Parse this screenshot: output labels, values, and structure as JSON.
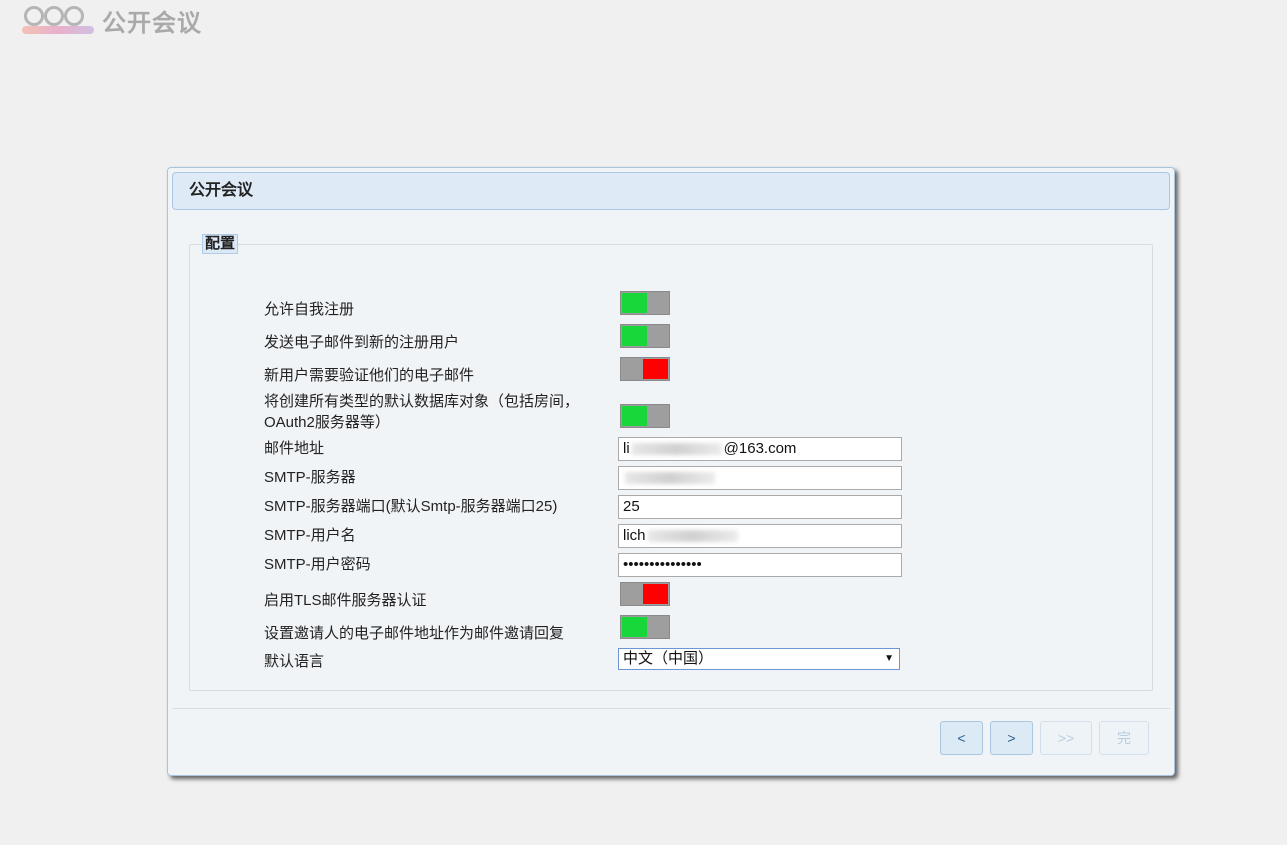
{
  "app": {
    "logo_text": "公开会议"
  },
  "dialog": {
    "title": "公开会议",
    "fieldset_legend": "配置",
    "settings": {
      "allow_self_registration": {
        "label": "允许自我注册",
        "state": "on"
      },
      "send_email_new_users": {
        "label": "发送电子邮件到新的注册用户",
        "state": "on"
      },
      "verify_email": {
        "label": "新用户需要验证他们的电子邮件",
        "state": "off"
      },
      "create_default_objects": {
        "label_line1": "将创建所有类型的默认数据库对象（包括房间，",
        "label_line2": "OAuth2服务器等）",
        "state": "on"
      },
      "mail_address": {
        "label": "邮件地址",
        "value_prefix": "li",
        "value_suffix": "@163.com"
      },
      "smtp_server": {
        "label": "SMTP-服务器"
      },
      "smtp_port": {
        "label": "SMTP-服务器端口(默认Smtp-服务器端口25)",
        "value": "25"
      },
      "smtp_user": {
        "label": "SMTP-用户名",
        "value_prefix": "lich"
      },
      "smtp_password": {
        "label": "SMTP-用户密码",
        "value": "•••••••••••••••"
      },
      "tls": {
        "label": "启用TLS邮件服务器认证",
        "state": "off"
      },
      "inviter_email_reply": {
        "label": "设置邀请人的电子邮件地址作为邮件邀请回复",
        "state": "on"
      },
      "default_language": {
        "label": "默认语言",
        "value": "中文（中国）"
      }
    },
    "buttons": {
      "prev": "<",
      "next": ">",
      "last": ">>",
      "finish": "完"
    }
  },
  "colors": {
    "toggle_on": "#17d73a",
    "toggle_off": "#ff0000",
    "toggle_track": "#9e9e9e"
  }
}
